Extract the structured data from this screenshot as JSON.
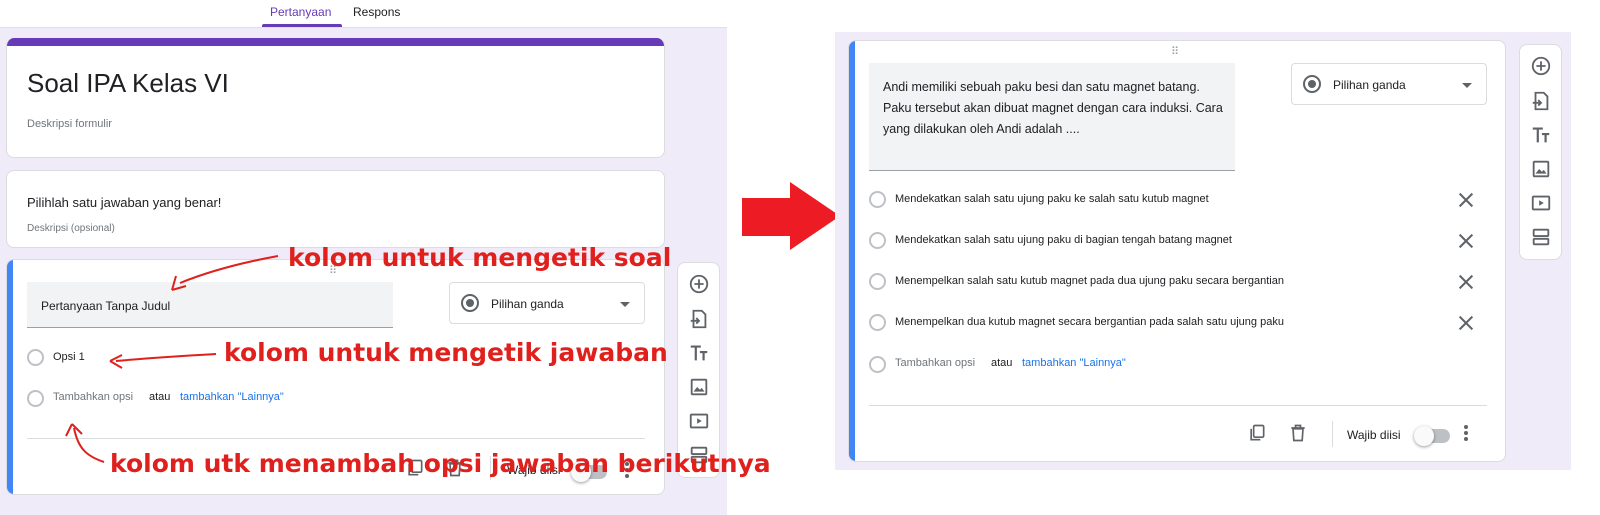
{
  "tabs": {
    "questions": "Pertanyaan",
    "responses": "Respons"
  },
  "form": {
    "title": "Soal IPA Kelas VI",
    "description_placeholder": "Deskripsi formulir"
  },
  "section": {
    "title": "Pilihlah satu jawaban yang benar!",
    "description_placeholder": "Deskripsi (opsional)"
  },
  "left_question": {
    "title": "Pertanyaan Tanpa Judul",
    "type": "Pilihan ganda",
    "options": [
      "Opsi 1"
    ],
    "add_option": "Tambahkan opsi",
    "or": "atau",
    "add_other": "tambahkan \"Lainnya\""
  },
  "annotations": {
    "question_field": "kolom untuk mengetik soal",
    "answer_field": "kolom untuk mengetik jawaban",
    "add_option_field": "kolom utk menambah opsi jawaban berikutnya"
  },
  "right_question": {
    "title": "Andi memiliki sebuah paku besi dan satu magnet batang. Paku tersebut akan dibuat magnet dengan cara induksi. Cara yang dilakukan oleh Andi adalah ....",
    "type": "Pilihan ganda",
    "options": [
      "Mendekatkan salah satu ujung paku ke salah satu kutub magnet",
      "Mendekatkan salah satu ujung paku di bagian tengah batang magnet",
      "Menempelkan salah satu kutub magnet pada dua ujung paku secara bergantian",
      "Menempelkan dua kutub magnet secara bergantian pada salah satu ujung paku"
    ],
    "add_option": "Tambahkan opsi",
    "or": "atau",
    "add_other": "tambahkan \"Lainnya\"",
    "required_label": "Wajib diisi"
  },
  "left_footer": {
    "required_label": "Wajib diisi"
  },
  "toolbar_icons": [
    "add-question-icon",
    "import-question-icon",
    "add-title-icon",
    "add-image-icon",
    "add-video-icon",
    "add-section-icon"
  ],
  "colors": {
    "accent_purple": "#673ab7",
    "accent_blue": "#4285f4",
    "annotation_red": "#e0201c",
    "link_blue": "#1a73e8"
  }
}
